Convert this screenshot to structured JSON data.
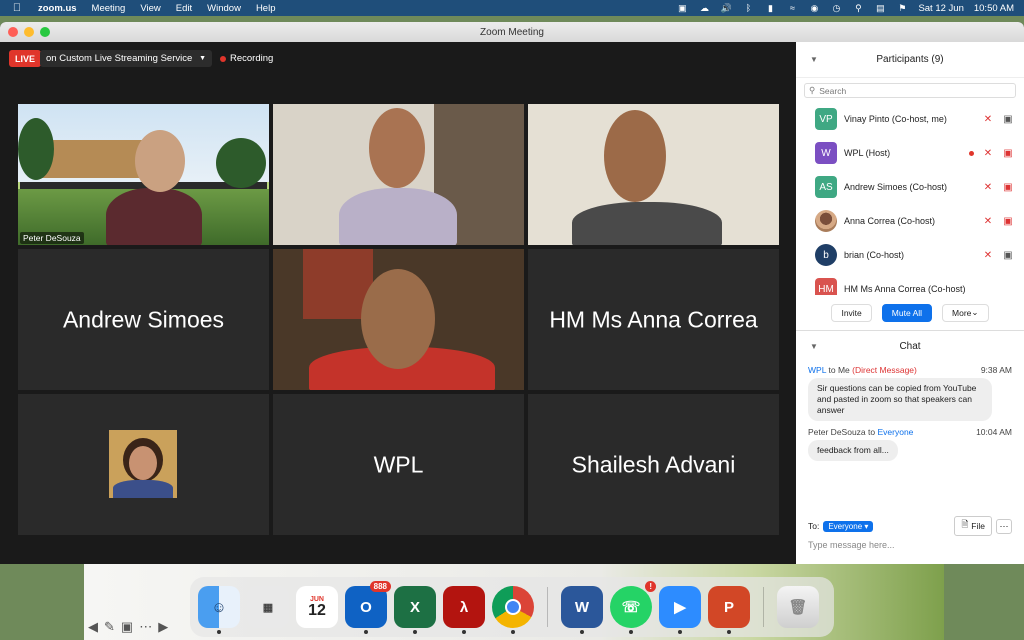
{
  "menubar": {
    "app_name": "zoom.us",
    "menus": [
      "Meeting",
      "View",
      "Edit",
      "Window",
      "Help"
    ],
    "date": "Sat 12 Jun",
    "time": "10:50 AM"
  },
  "window": {
    "title": "Zoom Meeting"
  },
  "meeting_toolbar": {
    "live_label": "LIVE",
    "stream_label": "on Custom Live Streaming Service",
    "recording_label": "Recording"
  },
  "tiles": [
    {
      "name": "Peter DeSouza"
    },
    {
      "name": "Andrew Simoes"
    },
    {
      "name": "HM Ms Anna Correa"
    },
    {
      "name": "WPL"
    },
    {
      "name": "Shailesh Advani"
    }
  ],
  "participants": {
    "header": "Participants (9)",
    "search_placeholder": "Search",
    "list": [
      {
        "initials": "VP",
        "name": "Vinay Pinto (Co-host, me)",
        "color": "#3fa883"
      },
      {
        "initials": "W",
        "name": "WPL (Host)",
        "color": "#7b4fc2"
      },
      {
        "initials": "AS",
        "name": "Andrew Simoes (Co-host)",
        "color": "#3fa883"
      },
      {
        "initials": "",
        "name": "Anna Correa (Co-host)",
        "color": "#c48d64"
      },
      {
        "initials": "b",
        "name": "brian (Co-host)",
        "color": "#1f3e66"
      },
      {
        "initials": "HM",
        "name": "HM Ms Anna Correa (Co-host)",
        "color": "#d9534f"
      }
    ],
    "invite_label": "Invite",
    "mute_all_label": "Mute All",
    "more_label": "More"
  },
  "chat": {
    "header": "Chat",
    "messages": [
      {
        "from": "WPL",
        "to_word": "to",
        "to": "Me",
        "tag": "(Direct Message)",
        "time": "9:38 AM",
        "text": "Sir questions can be copied from YouTube and pasted in zoom so that speakers can answer"
      },
      {
        "from": "Peter DeSouza",
        "to_word": "to",
        "to": "Everyone",
        "tag": "",
        "time": "10:04 AM",
        "text": "feedback from all..."
      }
    ],
    "to_label": "To:",
    "to_select": "Everyone",
    "file_label": "File",
    "input_placeholder": "Type message here..."
  },
  "dock": {
    "calendar_month": "JUN",
    "calendar_day": "12",
    "outlook_badge": "888",
    "whatsapp_badge": "!"
  }
}
